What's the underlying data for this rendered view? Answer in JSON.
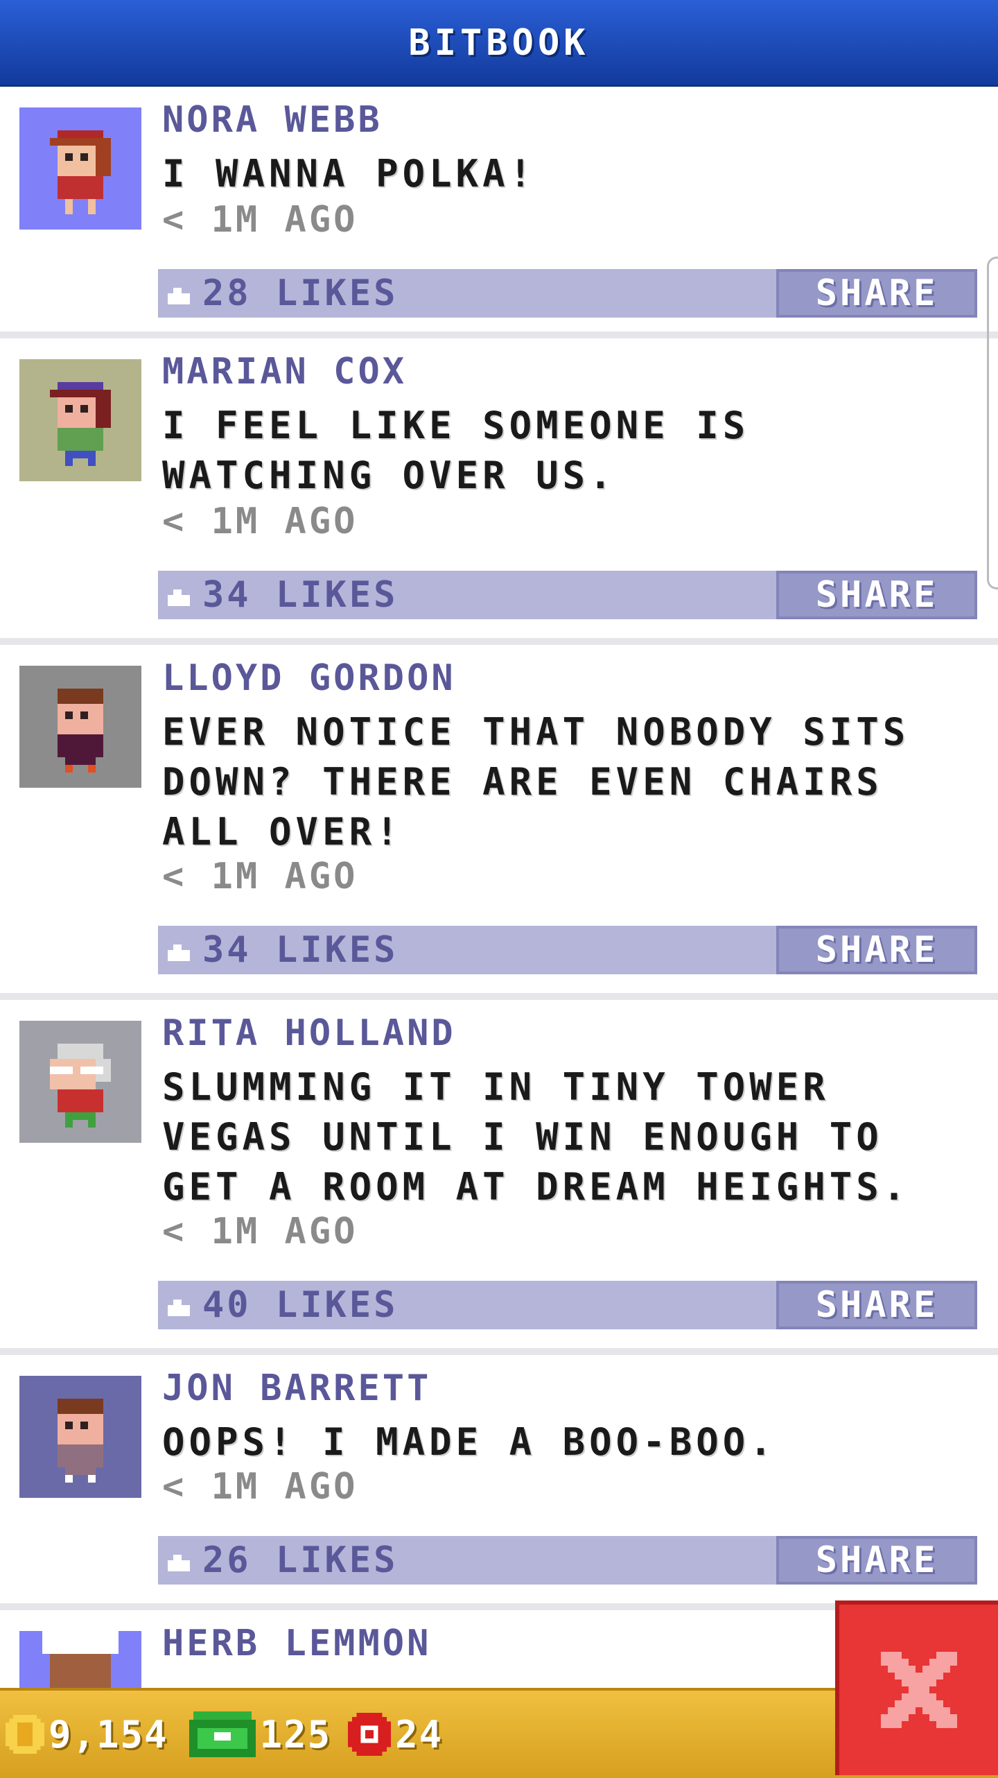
{
  "header": {
    "title": "BITBOOK"
  },
  "posts": [
    {
      "name": "NORA WEBB",
      "message": "I WANNA POLKA!",
      "time": "< 1M AGO",
      "likes": "28 LIKES",
      "share": "SHARE"
    },
    {
      "name": "MARIAN COX",
      "message": "I FEEL LIKE SOMEONE IS WATCHING OVER US.",
      "time": "< 1M AGO",
      "likes": "34 LIKES",
      "share": "SHARE"
    },
    {
      "name": "LLOYD GORDON",
      "message": "EVER NOTICE THAT NOBODY SITS DOWN? THERE ARE EVEN CHAIRS ALL OVER!",
      "time": "< 1M AGO",
      "likes": "34 LIKES",
      "share": "SHARE"
    },
    {
      "name": "RITA HOLLAND",
      "message": "SLUMMING IT IN TINY TOWER VEGAS UNTIL I WIN ENOUGH TO GET A ROOM AT DREAM HEIGHTS.",
      "time": "< 1M AGO",
      "likes": "40 LIKES",
      "share": "SHARE"
    },
    {
      "name": "JON BARRETT",
      "message": "OOPS! I MADE A BOO-BOO.",
      "time": "< 1M AGO",
      "likes": "26 LIKES",
      "share": "SHARE"
    },
    {
      "name": "HERB LEMMON"
    }
  ],
  "bottom_bar": {
    "coins": "9,154",
    "bux": "125",
    "chips": "24"
  },
  "colors": {
    "header": "#1e4bbf",
    "name": "#5a5899",
    "like_bar": "#b4b5d8",
    "share": "#9698c8",
    "close": "#e83535",
    "bottom_bar": "#e6b030"
  }
}
